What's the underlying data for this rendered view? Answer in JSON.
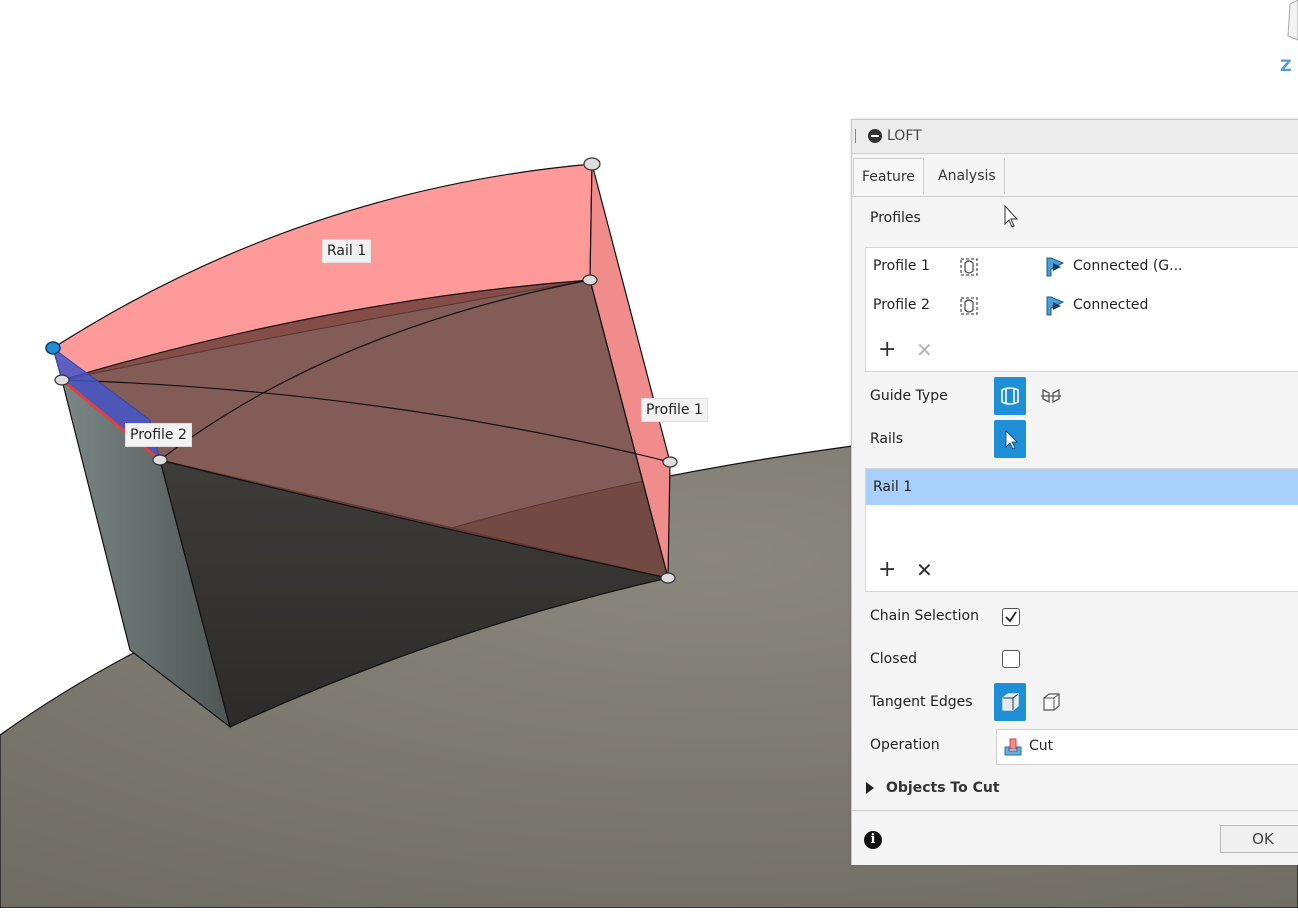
{
  "viewport": {
    "labels": {
      "rail": "Rail 1",
      "profile2": "Profile 2",
      "profile1": "Profile 1"
    },
    "viewcube_axis": "Z",
    "colors": {
      "loft_fill": "#ff8c8c",
      "ground": "#7a776e",
      "body": "#5e6262",
      "selection": "#1e8fd6"
    }
  },
  "panel": {
    "title": "LOFT",
    "tabs": [
      {
        "label": "Feature",
        "active": true
      },
      {
        "label": "Analysis",
        "active": false
      }
    ],
    "profiles_label": "Profiles",
    "profiles": [
      {
        "name": "Profile 1",
        "condition": "Connected (G..."
      },
      {
        "name": "Profile 2",
        "condition": "Connected"
      }
    ],
    "guide_type_label": "Guide Type",
    "rails_label": "Rails",
    "rails": [
      "Rail 1"
    ],
    "chain_selection_label": "Chain Selection",
    "chain_selection_checked": true,
    "closed_label": "Closed",
    "closed_checked": false,
    "tangent_edges_label": "Tangent Edges",
    "operation_label": "Operation",
    "operation_value": "Cut",
    "objects_to_cut_label": "Objects To Cut",
    "ok_label": "OK",
    "accent_color": "#1e8fd6"
  }
}
